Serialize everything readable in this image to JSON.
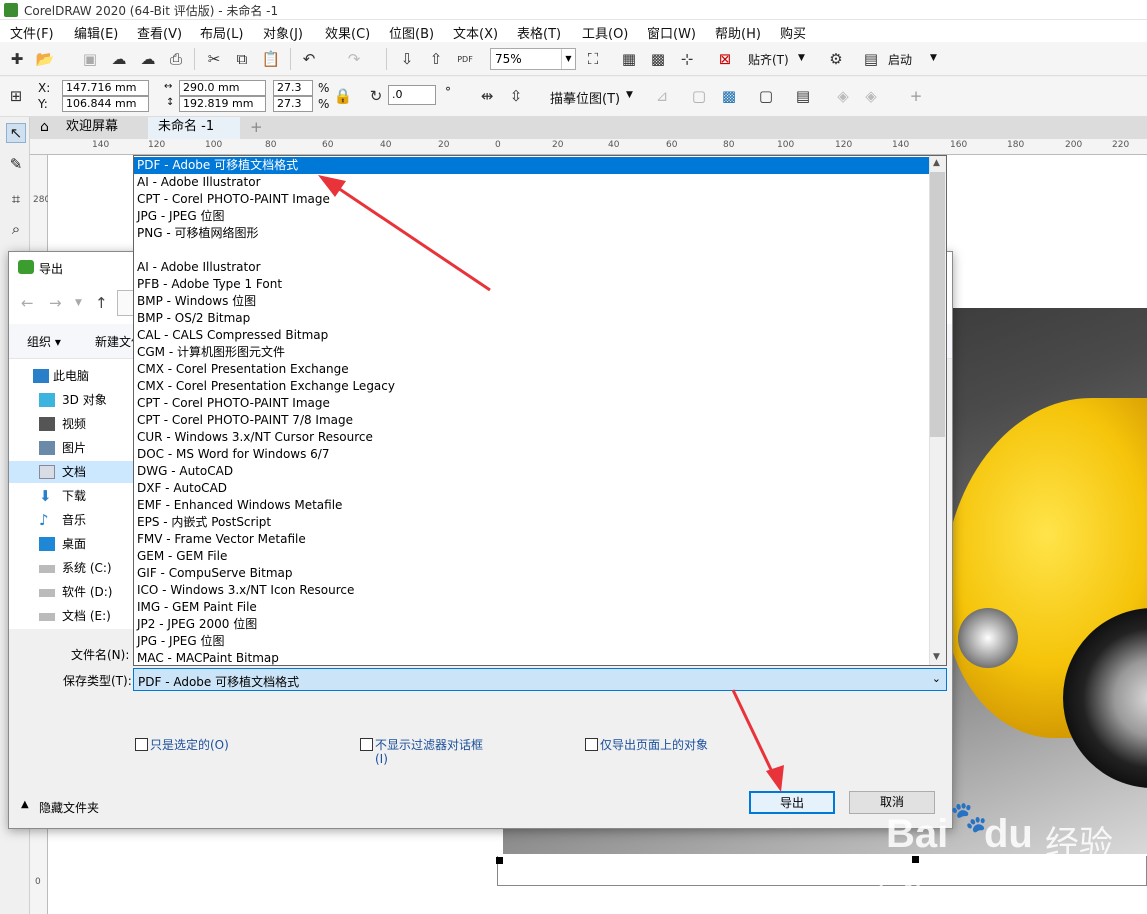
{
  "window": {
    "title": "CorelDRAW 2020 (64-Bit 评估版) - 未命名 -1"
  },
  "menu": [
    "文件(F)",
    "编辑(E)",
    "查看(V)",
    "布局(L)",
    "对象(J)",
    "效果(C)",
    "位图(B)",
    "文本(X)",
    "表格(T)",
    "工具(O)",
    "窗口(W)",
    "帮助(H)",
    "购买"
  ],
  "toolbar": {
    "zoom": "75%",
    "snap_label": "贴齐(T)",
    "launch_label": "启动",
    "pdf_label": "PDF"
  },
  "propbar": {
    "x_label": "X:",
    "y_label": "Y:",
    "x": "147.716 mm",
    "y": "106.844 mm",
    "w": "290.0 mm",
    "h": "192.819 mm",
    "sx": "27.3",
    "sy": "27.3",
    "pct": "%",
    "rotation": ".0",
    "deg": "°",
    "trace_label": "描摹位图(T)"
  },
  "tabs": [
    "欢迎屏幕",
    "未命名 -1"
  ],
  "ruler_h": [
    "140",
    "120",
    "100",
    "80",
    "60",
    "40",
    "20",
    "0",
    "20",
    "40",
    "60",
    "80",
    "100",
    "120",
    "140",
    "160",
    "180",
    "200",
    "220"
  ],
  "ruler_v": [
    "280",
    "0"
  ],
  "dialog": {
    "title": "导出",
    "cmd_organize": "组织 ▾",
    "cmd_newfolder": "新建文件",
    "tree": [
      "此电脑",
      "3D 对象",
      "视频",
      "图片",
      "文档",
      "下载",
      "音乐",
      "桌面",
      "系统 (C:)",
      "软件 (D:)",
      "文档 (E:)"
    ],
    "selected_tree_index": 4,
    "filename_label": "文件名(N):",
    "savetype_label": "保存类型(T):",
    "savetype_value": "PDF - Adobe 可移植文档格式",
    "checkbox_selected_only": "只是选定的(O)",
    "checkbox_no_filter_dialog_1": "不显示过滤器对话框",
    "checkbox_no_filter_dialog_2": "(I)",
    "checkbox_page_only": "仅导出页面上的对象",
    "hide_folders": "隐藏文件夹",
    "export_button": "导出",
    "cancel_button": "取消"
  },
  "dropdown": {
    "selected_index": 0,
    "items": [
      "PDF - Adobe 可移植文档格式",
      "AI - Adobe Illustrator",
      "CPT - Corel PHOTO-PAINT Image",
      "JPG - JPEG 位图",
      "PNG - 可移植网络图形",
      "",
      "AI - Adobe Illustrator",
      "PFB - Adobe Type 1 Font",
      "BMP - Windows 位图",
      "BMP - OS/2 Bitmap",
      "CAL - CALS Compressed Bitmap",
      "CGM - 计算机图形图元文件",
      "CMX - Corel Presentation Exchange",
      "CMX - Corel Presentation Exchange Legacy",
      "CPT - Corel PHOTO-PAINT Image",
      "CPT - Corel PHOTO-PAINT 7/8 Image",
      "CUR - Windows 3.x/NT Cursor Resource",
      "DOC - MS Word for Windows 6/7",
      "DWG - AutoCAD",
      "DXF - AutoCAD",
      "EMF - Enhanced Windows Metafile",
      "EPS - 内嵌式 PostScript",
      "FMV - Frame Vector Metafile",
      "GEM - GEM File",
      "GIF - CompuServe Bitmap",
      "ICO - Windows 3.x/NT Icon Resource",
      "IMG - GEM Paint File",
      "JP2 - JPEG 2000 位图",
      "JPG - JPEG 位图",
      "MAC - MACPaint Bitmap"
    ]
  },
  "watermark": {
    "brand": "Bai",
    "brand2": "du",
    "cn": "经验",
    "url": "jingyan.baidu.com"
  },
  "colors": {
    "selection": "#0078d7",
    "arrow": "#e8333a",
    "accent_green": "#3c8d2f"
  }
}
